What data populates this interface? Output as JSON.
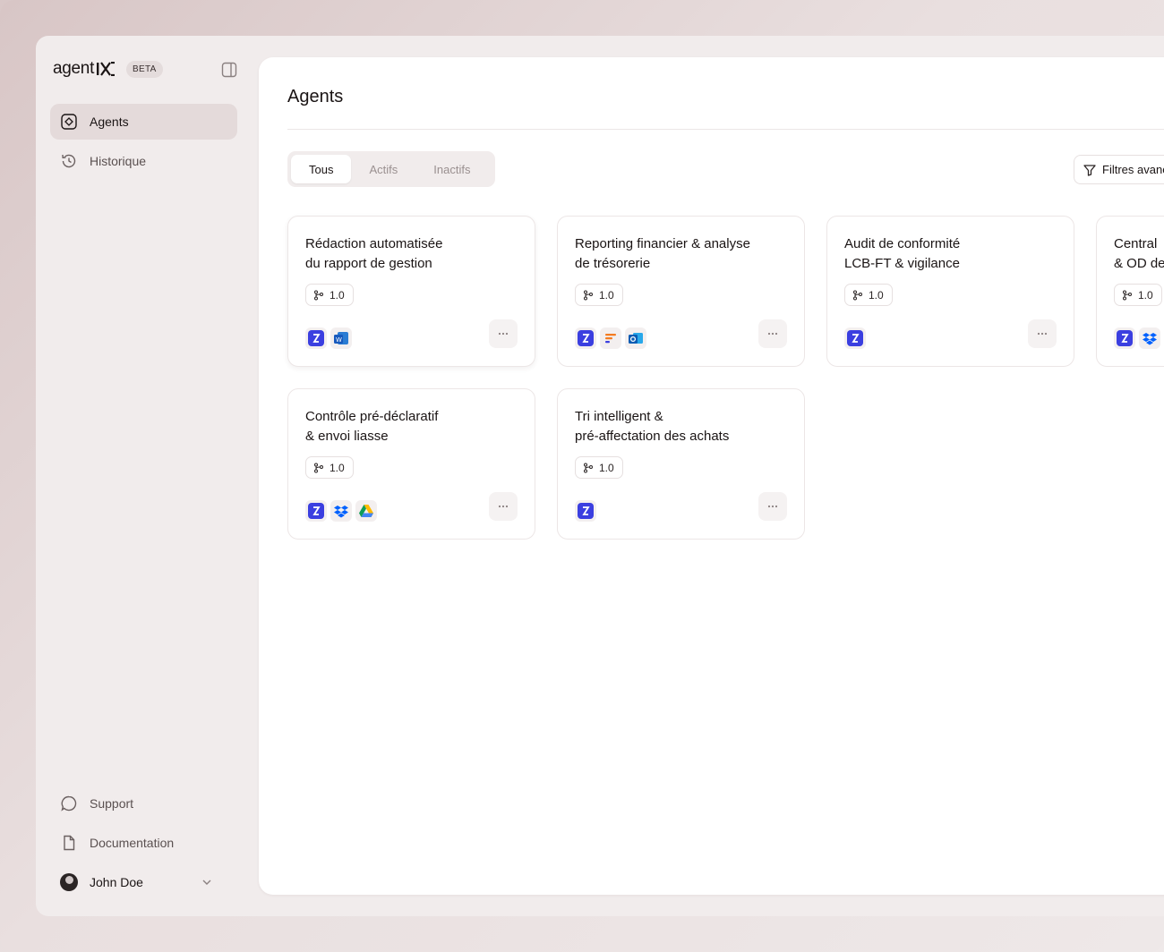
{
  "brand": {
    "name": "agent",
    "badge": "BETA"
  },
  "sidebar": {
    "nav": [
      {
        "label": "Agents",
        "icon": "agents-icon",
        "active": true
      },
      {
        "label": "Historique",
        "icon": "history-icon",
        "active": false
      }
    ],
    "bottom": [
      {
        "label": "Support",
        "icon": "chat-bubble-icon"
      },
      {
        "label": "Documentation",
        "icon": "document-icon"
      }
    ],
    "user": {
      "name": "John Doe"
    }
  },
  "main": {
    "title": "Agents",
    "tabs": [
      {
        "label": "Tous",
        "active": true
      },
      {
        "label": "Actifs",
        "active": false
      },
      {
        "label": "Inactifs",
        "active": false
      }
    ],
    "filters_label": "Filtres avancés",
    "cards": [
      {
        "title": "Rédaction automatisée\ndu rapport de gestion",
        "version": "1.0",
        "integrations": [
          "agent-icon",
          "word-icon"
        ]
      },
      {
        "title": "Reporting financier & analyse\nde trésorerie",
        "version": "1.0",
        "integrations": [
          "agent-icon",
          "bars-icon",
          "outlook-icon"
        ]
      },
      {
        "title": "Audit de conformité\nLCB-FT & vigilance",
        "version": "1.0",
        "integrations": [
          "agent-icon"
        ]
      },
      {
        "title": "Central\n& OD de",
        "version": "1.0",
        "integrations": [
          "agent-icon",
          "dropbox-icon"
        ]
      },
      {
        "title": "Contrôle pré-déclaratif\n& envoi liasse",
        "version": "1.0",
        "integrations": [
          "agent-icon",
          "dropbox-icon",
          "google-drive-icon"
        ]
      },
      {
        "title": "Tri intelligent &\npré-affectation des achats",
        "version": "1.0",
        "integrations": [
          "agent-icon"
        ]
      }
    ]
  },
  "colors": {
    "agent_icon": "#3b3fe0",
    "accent_bg": "#f1ecec"
  }
}
